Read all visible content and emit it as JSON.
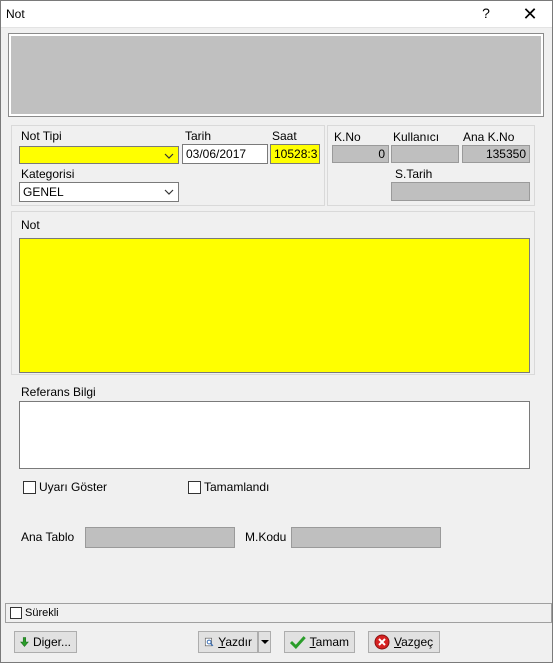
{
  "window": {
    "title": "Not",
    "help_icon": "?",
    "close_icon": "✕"
  },
  "form": {
    "not_tipi_label": "Not Tipi",
    "not_tipi_value": "",
    "tarih_label": "Tarih",
    "tarih_value": "03/06/2017",
    "saat_label": "Saat",
    "saat_value": "10528:3",
    "kategorisi_label": "Kategorisi",
    "kategorisi_value": "GENEL",
    "kno_label": "K.No",
    "kno_value": "0",
    "kullanici_label": "Kullanıcı",
    "kullanici_value": "",
    "ana_kno_label": "Ana K.No",
    "ana_kno_value": "135350",
    "starih_label": "S.Tarih",
    "starih_value": "",
    "not_label": "Not",
    "not_value": "",
    "referans_label": "Referans Bilgi",
    "referans_value": "",
    "uyari_label": "Uyarı Göster",
    "uyari_checked": false,
    "tamamlandi_label": "Tamamlandı",
    "tamamlandi_checked": false,
    "ana_tablo_label": "Ana Tablo",
    "ana_tablo_value": "",
    "mkodu_label": "M.Kodu",
    "mkodu_value": "",
    "surekli_label": "Sürekli",
    "surekli_checked": false
  },
  "buttons": {
    "diger": {
      "pre": "Di",
      "ul": "g",
      "post": "er..."
    },
    "yazdir": {
      "pre": "",
      "ul": "Y",
      "post": "azdır"
    },
    "tamam": {
      "pre": "",
      "ul": "T",
      "post": "amam"
    },
    "vazgec": {
      "pre": "",
      "ul": "V",
      "post": "azgeç"
    }
  },
  "colors": {
    "required_field": "#ffff00",
    "readonly_field": "#bfbfbf"
  }
}
